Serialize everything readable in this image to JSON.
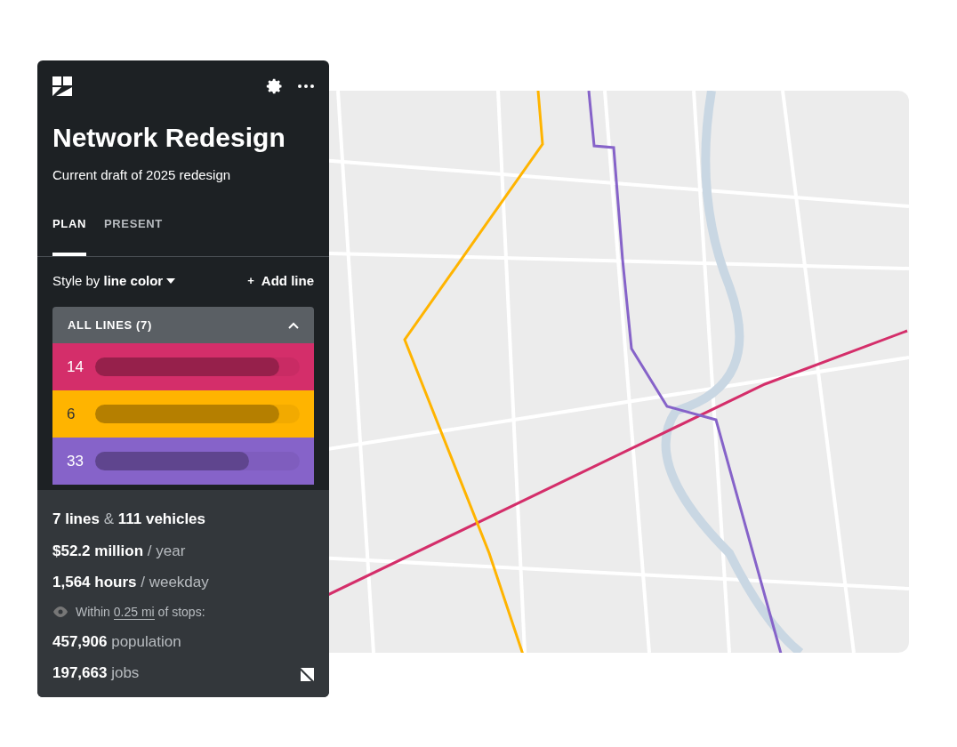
{
  "panel": {
    "title": "Network Redesign",
    "subtitle": "Current draft of 2025 redesign",
    "tabs": [
      {
        "label": "PLAN",
        "selected": true
      },
      {
        "label": "PRESENT",
        "selected": false
      }
    ],
    "style_by": {
      "prefix": "Style by",
      "value": "line color"
    },
    "add_line": {
      "icon": "+",
      "label": "Add line"
    },
    "lines_group": {
      "title": "ALL LINES (7)",
      "expanded": true
    },
    "lines": [
      {
        "name": "14",
        "color": "#d42e6a",
        "level": 0.9
      },
      {
        "name": "6",
        "color": "#ffb400",
        "level": 0.9
      },
      {
        "name": "33",
        "color": "#8663c9",
        "level": 0.75
      }
    ],
    "stats": [
      "**7 lines** & **111 vehicles**",
      "**$52.2 million** / year",
      "**1,564 hours** / weekday"
    ],
    "coverage": {
      "prefix": "Within",
      "link": "0.25 mi",
      "suffix": "of stops:"
    },
    "coverage_stats": [
      "**457,906** population",
      "**197,663** jobs"
    ]
  }
}
